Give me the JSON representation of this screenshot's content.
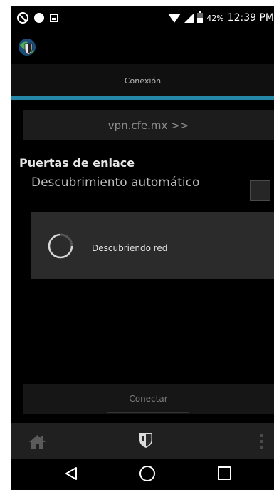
{
  "status_bar": {
    "battery_percent": "42%",
    "time": "12:39 PM",
    "left_icons": [
      "do-not-disturb-icon",
      "notification-dot-icon",
      "image-icon"
    ],
    "right_icons": [
      "wifi-icon",
      "signal-icon",
      "battery-icon"
    ]
  },
  "app_bar": {
    "icon": "globe-shield-app-icon"
  },
  "tab": {
    "label": "Conexión",
    "indicator_color": "#2a9fc4"
  },
  "server": {
    "label": "vpn.cfe.mx  >>"
  },
  "gateways": {
    "title": "Puertas de enlace",
    "auto_discovery_label": "Descubrimiento automático",
    "auto_discovery_checked": false
  },
  "progress": {
    "text": "Descubriendo red",
    "icon": "spinner-icon"
  },
  "connect": {
    "label": "Conectar"
  },
  "toolbar": {
    "icons": [
      "home-icon",
      "shield-icon",
      "overflow-menu-icon"
    ]
  },
  "nav_bar": {
    "icons": [
      "back-icon",
      "home-circle-icon",
      "recents-icon"
    ]
  }
}
